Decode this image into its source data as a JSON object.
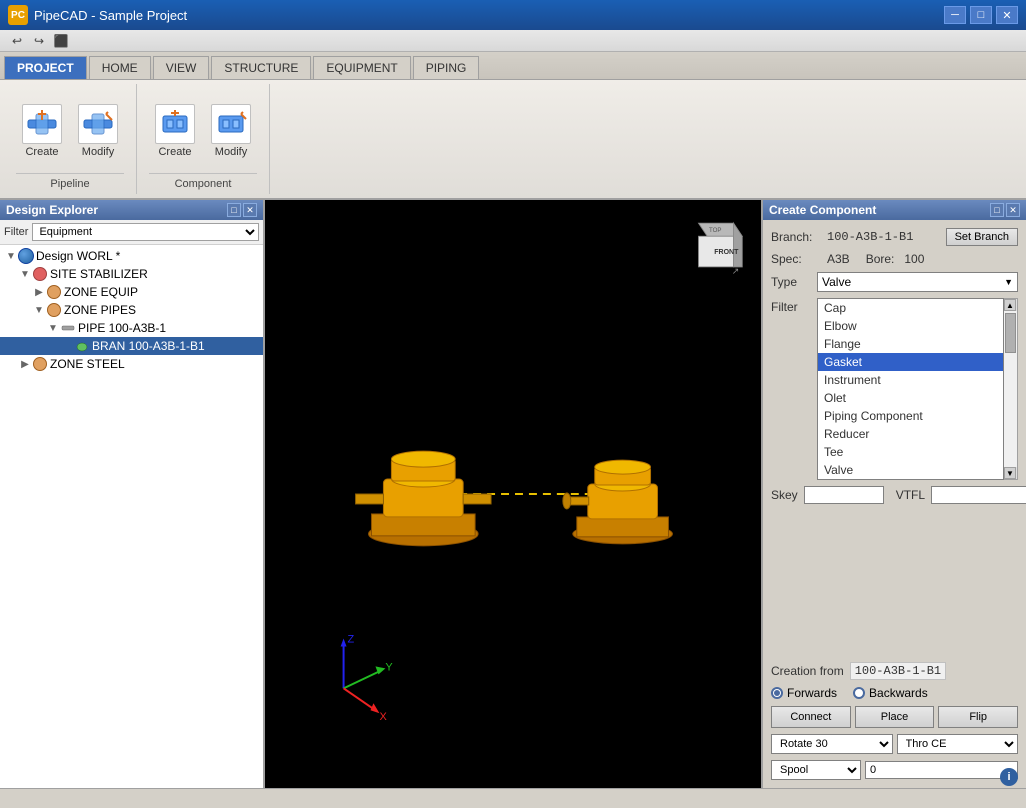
{
  "window": {
    "title": "PipeCAD - Sample Project",
    "icon": "PC"
  },
  "titlebar": {
    "minimize": "─",
    "maximize": "□",
    "close": "✕"
  },
  "quicktoolbar": {
    "undo": "↩",
    "redo": "↪",
    "save": "💾"
  },
  "ribbontabs": [
    {
      "id": "project",
      "label": "PROJECT",
      "active": true
    },
    {
      "id": "home",
      "label": "HOME",
      "active": false
    },
    {
      "id": "view",
      "label": "VIEW",
      "active": false
    },
    {
      "id": "structure",
      "label": "STRUCTURE",
      "active": false
    },
    {
      "id": "equipment",
      "label": "EQUIPMENT",
      "active": false
    },
    {
      "id": "piping",
      "label": "PIPING",
      "active": false
    }
  ],
  "ribbon": {
    "pipeline_group": {
      "label": "Pipeline",
      "create_label": "Create",
      "modify_label": "Modify"
    },
    "component_group": {
      "label": "Component",
      "create_label": "Create",
      "modify_label": "Modify"
    }
  },
  "designexplorer": {
    "title": "Design Explorer",
    "filter_label": "Filter",
    "filter_value": "Equipment",
    "tree": [
      {
        "id": "design_worl",
        "label": "Design WORL *",
        "icon": "globe",
        "indent": 0,
        "arrow": "▼"
      },
      {
        "id": "site_stabilizer",
        "label": "SITE STABILIZER",
        "icon": "site",
        "indent": 1,
        "arrow": "▼"
      },
      {
        "id": "zone_equip",
        "label": "ZONE EQUIP",
        "icon": "zone",
        "indent": 2,
        "arrow": "▶"
      },
      {
        "id": "zone_pipes",
        "label": "ZONE PIPES",
        "icon": "zone",
        "indent": 2,
        "arrow": "▼"
      },
      {
        "id": "pipe_100",
        "label": "PIPE 100-A3B-1",
        "icon": "pipe",
        "indent": 3,
        "arrow": "▼"
      },
      {
        "id": "bran_100",
        "label": "BRAN 100-A3B-1-B1",
        "icon": "branch",
        "indent": 4,
        "arrow": "",
        "selected": true
      },
      {
        "id": "zone_steel",
        "label": "ZONE STEEL",
        "icon": "zone",
        "indent": 1,
        "arrow": "▶"
      }
    ]
  },
  "createcomponent": {
    "title": "Create Component",
    "branch_label": "Branch:",
    "branch_value": "100-A3B-1-B1",
    "set_branch_btn": "Set Branch",
    "spec_label": "Spec:",
    "spec_value": "A3B",
    "bore_label": "Bore:",
    "bore_value": "100",
    "type_label": "Type",
    "type_value": "Valve",
    "filter_label": "Filter",
    "skey_label": "Skey",
    "vtfl_label": "VTFL",
    "type_options": [
      {
        "id": "cap",
        "label": "Cap",
        "selected": false
      },
      {
        "id": "elbow",
        "label": "Elbow",
        "selected": false
      },
      {
        "id": "flange",
        "label": "Flange",
        "selected": false
      },
      {
        "id": "gasket",
        "label": "Gasket",
        "selected": true
      },
      {
        "id": "instrument",
        "label": "Instrument",
        "selected": false
      },
      {
        "id": "olet",
        "label": "Olet",
        "selected": false
      },
      {
        "id": "piping_component",
        "label": "Piping Component",
        "selected": false
      },
      {
        "id": "reducer",
        "label": "Reducer",
        "selected": false
      },
      {
        "id": "tee",
        "label": "Tee",
        "selected": false
      },
      {
        "id": "valve",
        "label": "Valve",
        "selected": false
      }
    ],
    "creation_from_label": "Creation from",
    "creation_from_value": "100-A3B-1-B1",
    "forwards_label": "Forwards",
    "backwards_label": "Backwards",
    "connect_btn": "Connect",
    "place_btn": "Place",
    "flip_btn": "Flip",
    "rotate_label": "Rotate 30",
    "thro_label": "Thro CE",
    "spool_label": "Spool",
    "spool_value": "0"
  },
  "colors": {
    "accent_blue": "#3060a0",
    "ribbon_active": "#3c6fbe",
    "selected_row": "#3060c8",
    "highlight_gasket": "#3060c8",
    "equipment_yellow": "#e8a000"
  }
}
